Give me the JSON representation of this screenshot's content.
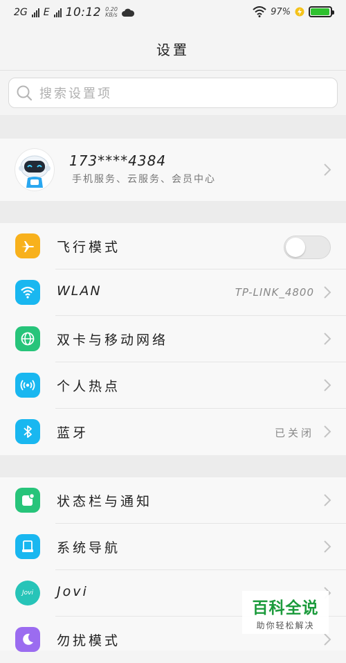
{
  "status_bar": {
    "network_1": "2G",
    "network_2": "E",
    "time": "10:12",
    "speed_value": "0.20",
    "speed_unit": "KB/s",
    "battery_percent": "97%",
    "battery_level": 0.97,
    "battery_color": "#2fc12f"
  },
  "header": {
    "title": "设置"
  },
  "search": {
    "placeholder": "搜索设置项"
  },
  "account": {
    "phone": "173****4384",
    "subtitle": "手机服务、云服务、会员中心"
  },
  "group1": [
    {
      "label": "飞行模式",
      "icon": "airplane-icon",
      "color": "#f8b11c",
      "toggle": "off"
    },
    {
      "label": "WLAN",
      "icon": "wifi-icon",
      "color": "#19b7f0",
      "value": "TP-LINK_4800"
    },
    {
      "label": "双卡与移动网络",
      "icon": "globe-icon",
      "color": "#27c47a"
    },
    {
      "label": "个人热点",
      "icon": "hotspot-icon",
      "color": "#19b7f0"
    },
    {
      "label": "蓝牙",
      "icon": "bluetooth-icon",
      "color": "#19b7f0",
      "value": "已关闭"
    }
  ],
  "group2": [
    {
      "label": "状态栏与通知",
      "icon": "notification-icon",
      "color": "#27c47a"
    },
    {
      "label": "系统导航",
      "icon": "navigation-icon",
      "color": "#19b7f0"
    },
    {
      "label": "Jovi",
      "icon": "jovi-icon",
      "color": "#27c4b8",
      "icon_text": "Jovi"
    },
    {
      "label": "勿扰模式",
      "icon": "moon-icon",
      "color": "#9b6cf0"
    }
  ],
  "watermark": {
    "main": "百科全说",
    "sub": "助你轻松解决"
  }
}
